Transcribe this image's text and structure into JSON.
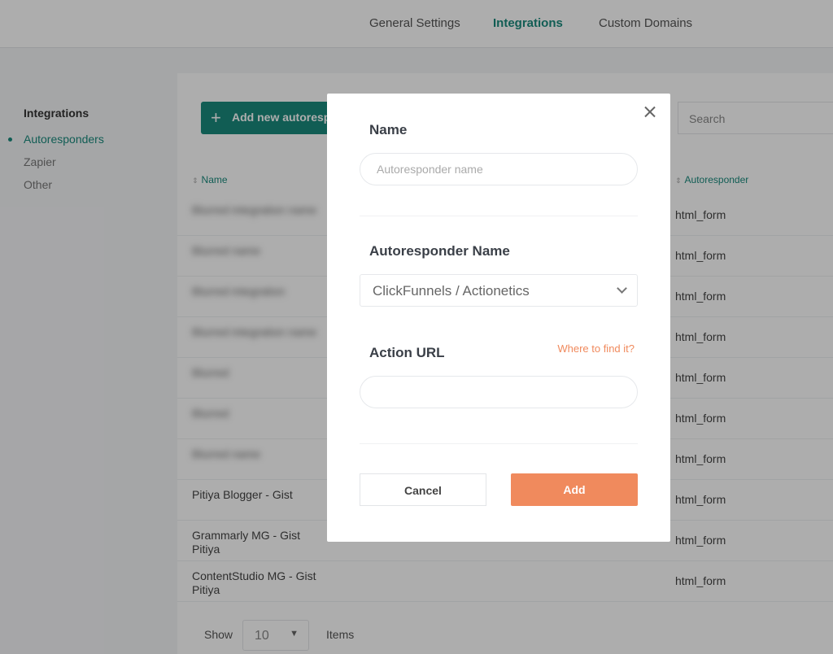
{
  "topnav": {
    "tabs": [
      {
        "label": "General Settings",
        "active": false
      },
      {
        "label": "Integrations",
        "active": true
      },
      {
        "label": "Custom Domains",
        "active": false
      }
    ]
  },
  "sidebar": {
    "heading": "Integrations",
    "items": [
      {
        "label": "Autoresponders",
        "active": true
      },
      {
        "label": "Zapier",
        "active": false
      },
      {
        "label": "Other",
        "active": false
      }
    ]
  },
  "main": {
    "add_button_label": "Add new autoresponder",
    "search_placeholder": "Search",
    "columns": {
      "name": "Name",
      "autoresponder": "Autoresponder"
    },
    "rows": [
      {
        "name": "Blurred integration name",
        "autoresponder": "html_form",
        "blurred": true
      },
      {
        "name": "Blurred name",
        "autoresponder": "html_form",
        "blurred": true
      },
      {
        "name": "Blurred integration",
        "autoresponder": "html_form",
        "blurred": true
      },
      {
        "name": "Blurred integration name",
        "autoresponder": "html_form",
        "blurred": true
      },
      {
        "name": "Blurred",
        "autoresponder": "html_form",
        "blurred": true
      },
      {
        "name": "Blurred",
        "autoresponder": "html_form",
        "blurred": true
      },
      {
        "name": "Blurred name",
        "autoresponder": "html_form",
        "blurred": true
      },
      {
        "name": "Pitiya Blogger - Gist",
        "autoresponder": "html_form",
        "blurred": false
      },
      {
        "name": "Grammarly MG - Gist Pitiya",
        "autoresponder": "html_form",
        "blurred": false
      },
      {
        "name": "ContentStudio MG - Gist Pitiya",
        "autoresponder": "html_form",
        "blurred": false
      }
    ],
    "pager": {
      "show_label": "Show",
      "page_size": "10",
      "items_label": "Items"
    }
  },
  "modal": {
    "name_label": "Name",
    "name_placeholder": "Autoresponder name",
    "autoresponder_label": "Autoresponder Name",
    "autoresponder_value": "ClickFunnels / Actionetics",
    "action_url_label": "Action URL",
    "where_link": "Where to find it?",
    "action_url_value": "",
    "cancel_label": "Cancel",
    "add_label": "Add"
  },
  "colors": {
    "accent": "#1a8a7d",
    "primary_action": "#f08a5d"
  }
}
